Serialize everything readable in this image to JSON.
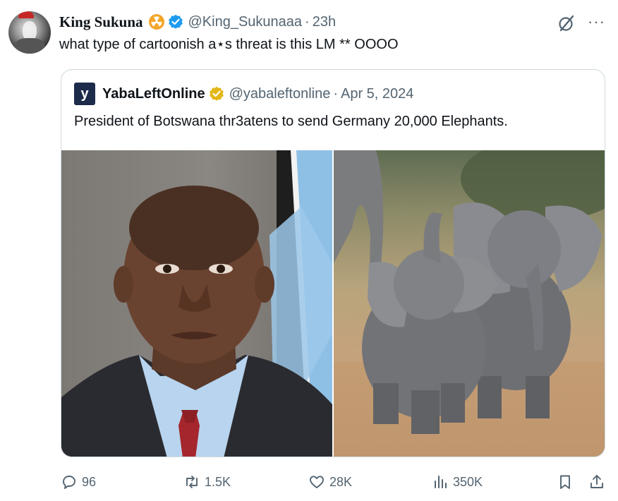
{
  "tweet": {
    "display_name": "King Sukuna",
    "handle": "@King_Sukunaaa",
    "separator": "·",
    "time": "23h",
    "text": "what type of cartoonish a⋆s threat is this LM ** OOOO"
  },
  "quoted": {
    "logo_letter": "y",
    "display_name": "YabaLeftOnline",
    "handle": "@yabaleftonline",
    "separator": "·",
    "date": "Apr 5, 2024",
    "text": "President of Botswana thr3atens to send Germany 20,000 Elephants."
  },
  "stats": {
    "replies": "96",
    "reposts": "1.5K",
    "likes": "28K",
    "views": "350K"
  },
  "icons": {
    "reply": "speech-bubble-icon",
    "repost": "repost-arrows-icon",
    "like": "heart-icon",
    "views": "bar-chart-icon",
    "bookmark": "bookmark-icon",
    "share": "share-icon",
    "grok": "grok-slash-icon",
    "more": "more-dots-icon"
  },
  "colors": {
    "verified_blue": "#1d9bf0",
    "verified_gold": "#e2b719",
    "muted_text": "#536471"
  }
}
